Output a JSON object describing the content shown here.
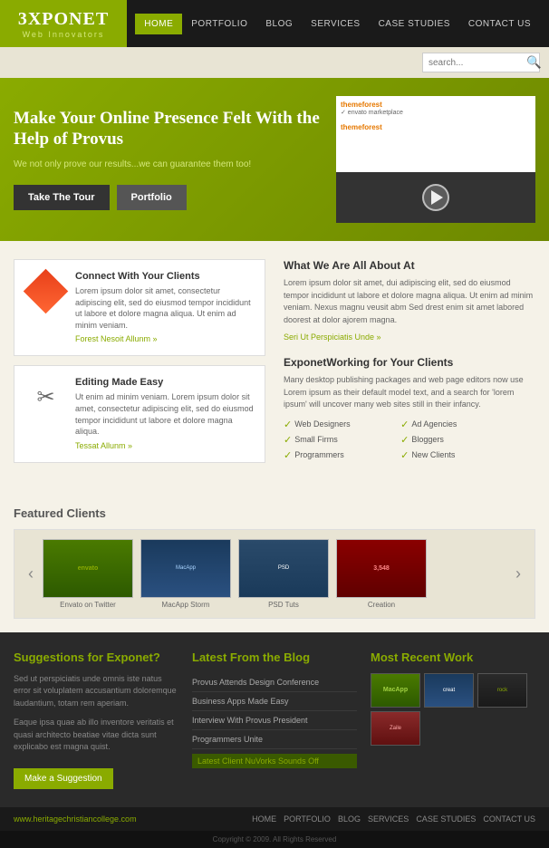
{
  "header": {
    "logo": "3XPONET",
    "logo_sub": "Web Innovators",
    "nav": [
      {
        "label": "HOME",
        "active": true
      },
      {
        "label": "PORTFOLIO",
        "active": false
      },
      {
        "label": "BLOG",
        "active": false
      },
      {
        "label": "SERVICES",
        "active": false
      },
      {
        "label": "CASE STUDIES",
        "active": false
      },
      {
        "label": "CONTACT US",
        "active": false
      }
    ],
    "search_placeholder": "search..."
  },
  "hero": {
    "title": "Make Your Online Presence Felt With the Help of Provus",
    "subtitle": "We not only prove our results...we can guarantee them too!",
    "btn_tour": "Take The Tour",
    "btn_portfolio": "Portfolio"
  },
  "features": {
    "left": [
      {
        "title": "Connect With Your Clients",
        "body": "Lorem ipsum dolor sit amet, consectetur adipiscing elit, sed do eiusmod tempor incididunt ut labore et dolore magna aliqua. Ut enim ad minim veniam.",
        "link": "Forest Nesoit Allunm »"
      },
      {
        "title": "Editing Made Easy",
        "body": "Ut enim ad minim veniam. Lorem ipsum dolor sit amet, consectetur adipiscing elit, sed do eiusmod tempor incididunt ut labore et dolore magna aliqua.",
        "link": "Tessat Allunm »"
      }
    ],
    "right_top": {
      "title": "What We Are All About At",
      "body": "Lorem ipsum dolor sit amet, dui adipiscing elit, sed do eiusmod tempor incididunt ut labore et dolore magna aliqua. Ut enim ad minim veniam. Nexus magnu veusit abm Sed drest enim sit amet labored doorest at dolor ajorem magna.",
      "link": "Seri Ut Perspiciatis Unde »"
    },
    "right_bottom": {
      "title": "ExponetWorking for Your Clients",
      "body": "Many desktop publishing packages and web page editors now use Lorem ipsum as their default model text, and a search for 'lorem ipsum' will uncover many web sites still in their infancy.",
      "clients": [
        "Web Designers",
        "Ad Agencies",
        "Small Firms",
        "Bloggers",
        "Programmers",
        "New Clients"
      ]
    }
  },
  "featured": {
    "title": "Featured Clients",
    "items": [
      {
        "label": "Envato on Twitter"
      },
      {
        "label": "MacApp Storm"
      },
      {
        "label": "PSD Tuts"
      },
      {
        "label": "Creation"
      }
    ]
  },
  "footer": {
    "col1": {
      "title": "Suggestions for ",
      "brand": "Exponet?",
      "body1": "Sed ut perspiciatis unde omnis iste natus error sit voluplatem accusantium doloremque laudantium, totam rem aperiam.",
      "body2": "Eaque ipsa quae ab illo inventore veritatis et quasi architecto beatiae vitae dicta sunt explicabo est magna quist.",
      "btn": "Make a Suggestion"
    },
    "col2": {
      "title": "Latest From the ",
      "brand": "Blog",
      "links": [
        "Provus Attends Design Conference",
        "Business Apps Made Easy",
        "Interview With Provus President",
        "Programmers Unite",
        "Latest Client NuVorks Sounds Off"
      ]
    },
    "col3": {
      "title": "Most Recent ",
      "brand": "Work"
    }
  },
  "bottom": {
    "url": "www.heritagechristiancollege.com",
    "nav": [
      "HOME",
      "PORTFOLIO",
      "BLOG",
      "SERVICES",
      "CASE STUDIES",
      "CONTACT US"
    ],
    "copyright": "Copyright © 2009. All Rights Reserved"
  }
}
